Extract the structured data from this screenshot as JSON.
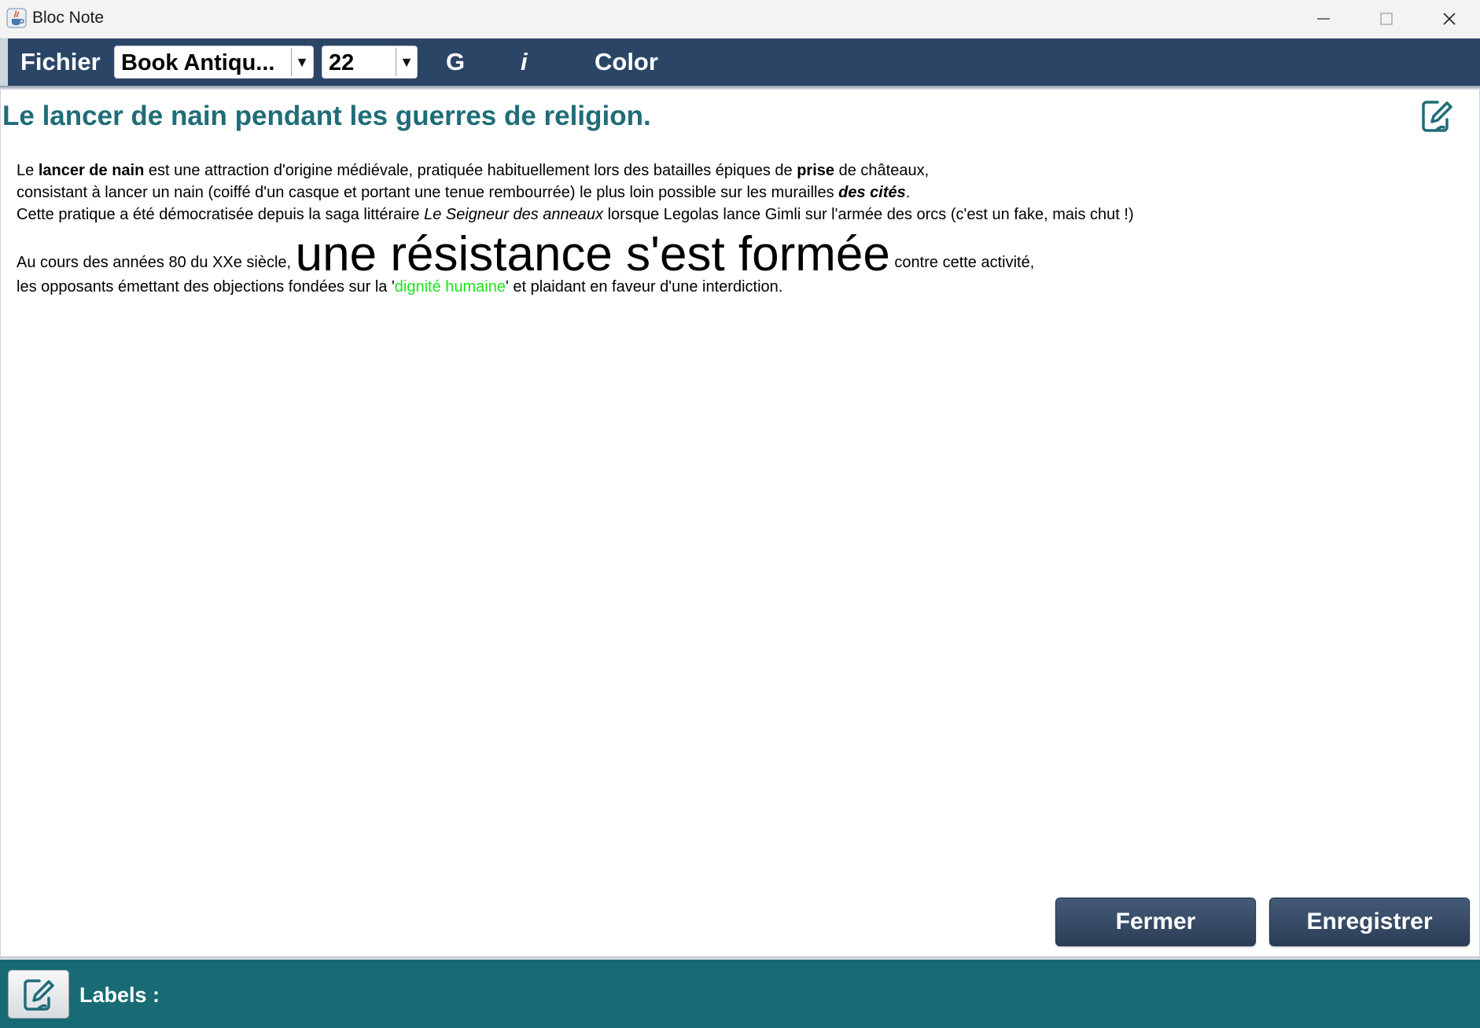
{
  "window": {
    "title": "Bloc Note"
  },
  "toolbar": {
    "file_menu": "Fichier",
    "font_family": "Book Antiqu...",
    "font_size": "22",
    "bold_label": "G",
    "italic_label": "i",
    "color_label": "Color"
  },
  "note": {
    "title": "Le lancer de nain pendant les guerres de religion.",
    "p1_line1": {
      "a": "Le ",
      "b_bold": "lancer de nain",
      "c": " est une attraction d'origine médiévale, pratiquée habituellement lors des batailles épiques de ",
      "d_bold": "prise",
      "e": " de châteaux,"
    },
    "p1_line2": {
      "a": "consistant à lancer un nain (coiffé d'un casque et portant une tenue rembourrée) le plus loin possible sur les murailles ",
      "b_bold_italic": "des cités",
      "c": "."
    },
    "p1_line3": {
      "a": "Cette pratique a été démocratisée depuis la saga littéraire ",
      "b_italic": "Le Seigneur des anneaux",
      "c": " lorsque Legolas lance Gimli sur l'armée des orcs (c'est un fake, mais chut !)"
    },
    "p2": {
      "a": "Au cours des années 80 du XXe siècle, ",
      "b_large": "une résistance s'est formée",
      "c": " contre cette activité,"
    },
    "p3": {
      "a": "les opposants émettant des objections fondées sur la '",
      "b_green": "dignité humaine",
      "c": "' et plaidant en faveur d'une interdiction."
    },
    "green_color": "#19e619",
    "title_color": "#1f6d78"
  },
  "actions": {
    "close_label": "Fermer",
    "save_label": "Enregistrer"
  },
  "footer": {
    "labels_title": "Labels :"
  },
  "icons": {
    "app": "java-cup-icon",
    "edit": "edit-note-icon"
  },
  "colors": {
    "toolbar_bg": "#2b4566",
    "footer_bg": "#186b74",
    "button_bg": "#2f4360"
  }
}
